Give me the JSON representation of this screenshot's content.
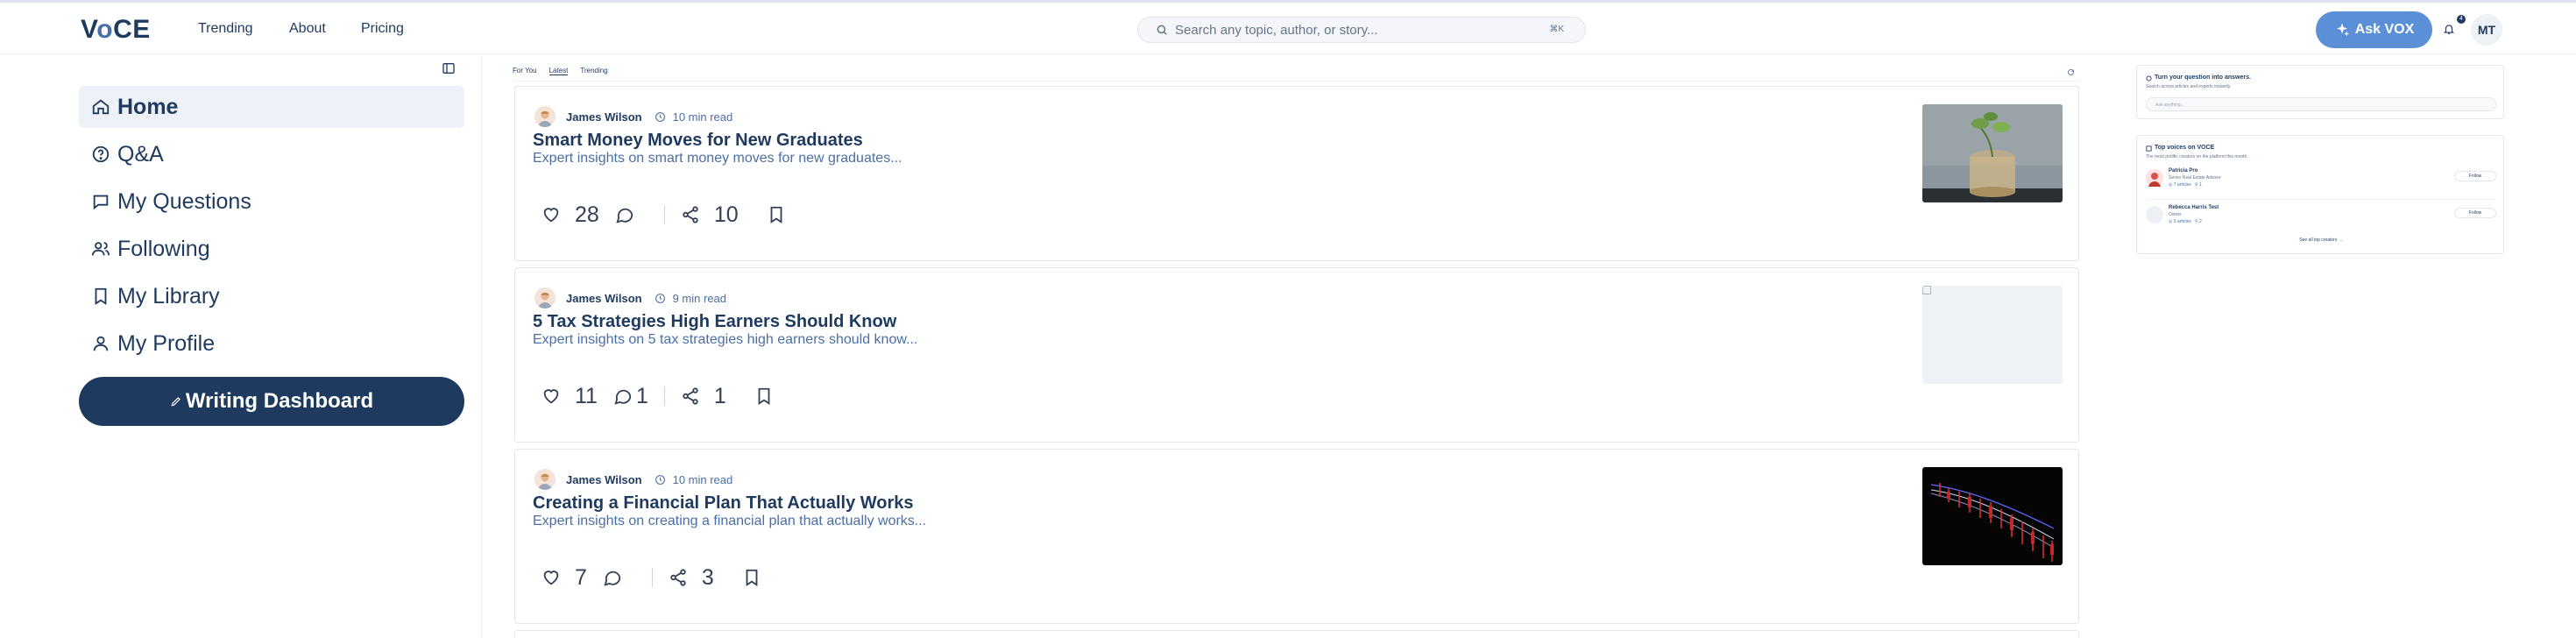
{
  "brand": {
    "logo_v": "V",
    "logo_o": "o",
    "logo_rest": "CE"
  },
  "nav": {
    "trending": "Trending",
    "about": "About",
    "pricing": "Pricing"
  },
  "search": {
    "placeholder": "Search any topic, author, or story...",
    "shortcut": "⌘K"
  },
  "header": {
    "ask_label": "Ask VOX",
    "notifications_count": "4",
    "user_initials": "MT"
  },
  "sidebar": {
    "items": [
      {
        "label": "Home",
        "icon": "home-icon"
      },
      {
        "label": "Q&A",
        "icon": "question-circle-icon"
      },
      {
        "label": "My Questions",
        "icon": "chat-bubble-icon"
      },
      {
        "label": "Following",
        "icon": "users-icon"
      },
      {
        "label": "My Library",
        "icon": "bookmark-icon"
      },
      {
        "label": "My Profile",
        "icon": "user-icon"
      }
    ],
    "writing_label": "Writing Dashboard"
  },
  "feed": {
    "tabs": [
      "For You",
      "Latest",
      "Trending"
    ],
    "active_tab": "Latest",
    "posts": [
      {
        "author": "James Wilson",
        "read_time": "10 min read",
        "title": "Smart Money Moves for New Graduates",
        "excerpt": "Expert insights on smart money moves for new graduates...",
        "likes": "28",
        "comments": "",
        "shares": "10",
        "thumb": "coins-plant-photo"
      },
      {
        "author": "James Wilson",
        "read_time": "9 min read",
        "title": "5 Tax Strategies High Earners Should Know",
        "excerpt": "Expert insights on 5 tax strategies high earners should know...",
        "likes": "11",
        "comments": "1",
        "shares": "1",
        "thumb": "empty-placeholder"
      },
      {
        "author": "James Wilson",
        "read_time": "10 min read",
        "title": "Creating a Financial Plan That Actually Works",
        "excerpt": "Expert insights on creating a financial plan that actually works...",
        "likes": "7",
        "comments": "",
        "shares": "3",
        "thumb": "candlestick-chart-photo"
      }
    ]
  },
  "rail": {
    "ask": {
      "title": "Turn your question into answers.",
      "subtitle": "Search across articles and experts instantly.",
      "placeholder": "Ask anything..."
    },
    "voices": {
      "title": "Top voices on VOCE",
      "subtitle": "The most prolific creators on the platform this month.",
      "people": [
        {
          "name": "Patricia Pro",
          "role": "Senior Real Estate Advisor",
          "articles": "7 articles",
          "followers": "1",
          "follow": "Follow"
        },
        {
          "name": "Rebecca Harris Test",
          "role": "Owner",
          "articles": "3 articles",
          "followers": "2",
          "follow": "Follow"
        }
      ],
      "see_all": "See all top creators →"
    }
  },
  "colors": {
    "primary": "#1e3a5f",
    "accent": "#5b8fd6",
    "muted": "#4a6fa5"
  }
}
